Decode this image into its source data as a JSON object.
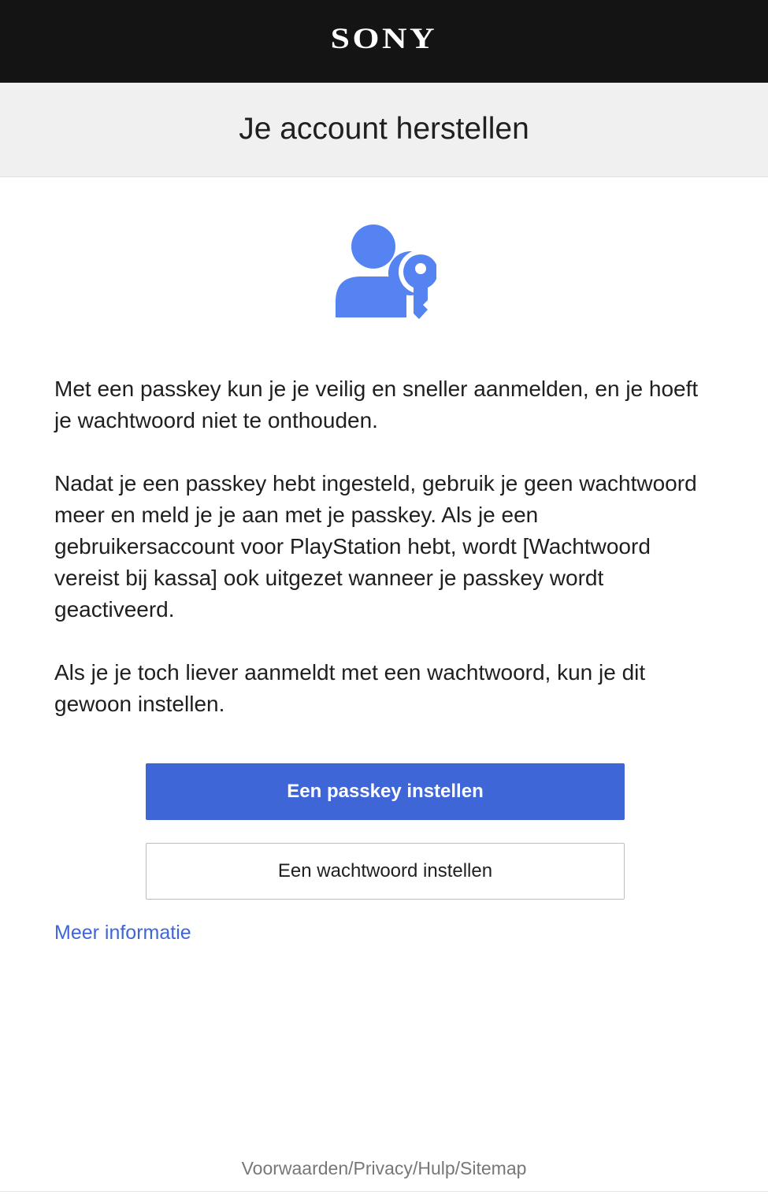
{
  "header": {
    "logo_text": "SONY"
  },
  "title_band": {
    "title": "Je account herstellen"
  },
  "icon": {
    "name": "user-key-icon",
    "color": "#5583f2"
  },
  "content": {
    "paragraph_1": "Met een passkey kun je je veilig en sneller aanmelden, en je hoeft je wachtwoord niet te onthouden.",
    "paragraph_2": "Nadat je een passkey hebt ingesteld, gebruik je geen wachtwoord meer en meld je je aan met je passkey. Als je een gebruikersaccount voor PlayStation hebt, wordt [Wachtwoord vereist bij kassa] ook uitgezet wanneer je passkey wordt geactiveerd.",
    "paragraph_3": "Als je je toch liever aanmeldt met een wachtwoord, kun je dit gewoon instellen."
  },
  "actions": {
    "primary_label": "Een passkey instellen",
    "secondary_label": "Een wachtwoord instellen",
    "more_info_label": "Meer informatie"
  },
  "footer": {
    "terms": "Voorwaarden",
    "privacy": "Privacy",
    "help": "Hulp",
    "sitemap": "Sitemap",
    "separator": "/"
  },
  "colors": {
    "header_bg": "#141414",
    "title_band_bg": "#f0f0f0",
    "primary_button": "#3f66d6",
    "link": "#3f66d6"
  }
}
